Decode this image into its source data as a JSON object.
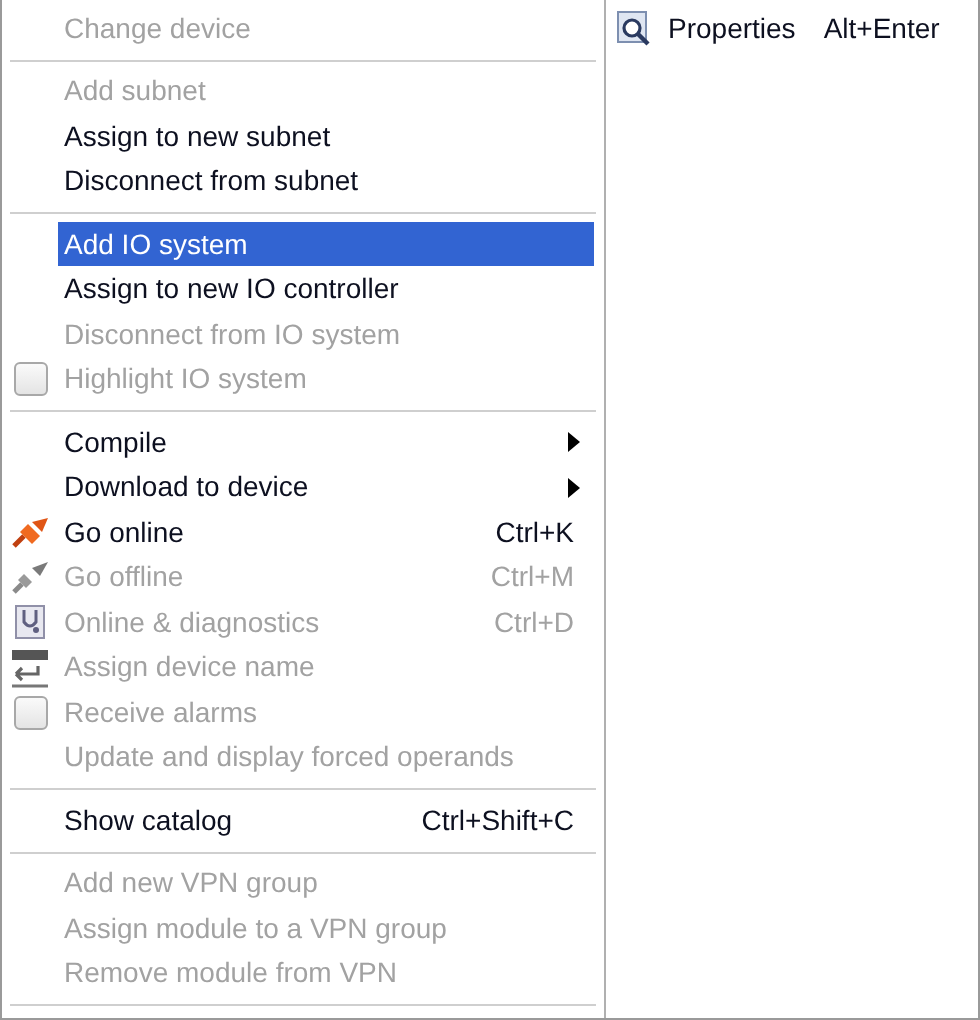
{
  "menu": {
    "groups": [
      {
        "items": [
          {
            "label": "Change device",
            "disabled": true,
            "selected": false,
            "kind": "text"
          }
        ]
      },
      {
        "items": [
          {
            "label": "Add subnet",
            "disabled": true,
            "selected": false,
            "kind": "text"
          },
          {
            "label": "Assign to new subnet",
            "disabled": false,
            "selected": false,
            "kind": "text"
          },
          {
            "label": "Disconnect from subnet",
            "disabled": false,
            "selected": false,
            "kind": "text"
          }
        ]
      },
      {
        "items": [
          {
            "label": "Add IO system",
            "disabled": false,
            "selected": true,
            "kind": "text"
          },
          {
            "label": "Assign to new IO controller",
            "disabled": false,
            "selected": false,
            "kind": "text"
          },
          {
            "label": "Disconnect from IO system",
            "disabled": true,
            "selected": false,
            "kind": "text"
          },
          {
            "label": "Highlight IO system",
            "disabled": true,
            "selected": false,
            "kind": "checkbox",
            "checked": false
          }
        ]
      },
      {
        "items": [
          {
            "label": "Compile",
            "disabled": false,
            "selected": false,
            "kind": "text",
            "submenu": true
          },
          {
            "label": "Download to device",
            "disabled": false,
            "selected": false,
            "kind": "text",
            "submenu": true
          },
          {
            "label": "Go online",
            "disabled": false,
            "selected": false,
            "kind": "connect",
            "shortcut": "Ctrl+K"
          },
          {
            "label": "Go offline",
            "disabled": true,
            "selected": false,
            "kind": "disconnect",
            "shortcut": "Ctrl+M"
          },
          {
            "label": "Online & diagnostics",
            "disabled": true,
            "selected": false,
            "kind": "diagnose",
            "shortcut": "Ctrl+D"
          },
          {
            "label": "Assign device name",
            "disabled": true,
            "selected": false,
            "kind": "rename"
          },
          {
            "label": "Receive alarms",
            "disabled": true,
            "selected": false,
            "kind": "checkbox",
            "checked": false
          },
          {
            "label": "Update and display forced operands",
            "disabled": true,
            "selected": false,
            "kind": "text"
          }
        ]
      },
      {
        "items": [
          {
            "label": "Show catalog",
            "disabled": false,
            "selected": false,
            "kind": "text",
            "shortcut": "Ctrl+Shift+C"
          }
        ]
      },
      {
        "items": [
          {
            "label": "Add new VPN group",
            "disabled": true,
            "selected": false,
            "kind": "text"
          },
          {
            "label": "Assign module to a VPN group",
            "disabled": true,
            "selected": false,
            "kind": "text"
          },
          {
            "label": "Remove module from VPN",
            "disabled": true,
            "selected": false,
            "kind": "text"
          }
        ]
      }
    ]
  },
  "side_menu": {
    "items": [
      {
        "label": "Properties",
        "disabled": false,
        "selected": false,
        "kind": "properties",
        "shortcut": "Alt+Enter"
      }
    ]
  }
}
